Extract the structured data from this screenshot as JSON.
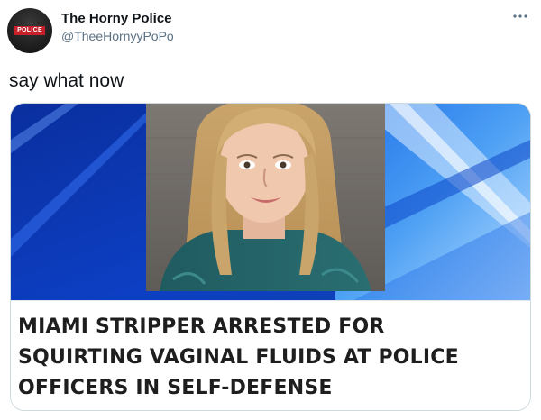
{
  "author": {
    "display_name": "The Horny Police",
    "handle": "@TheeHornyyPoPo",
    "avatar_badge_text": "POLICE"
  },
  "tweet": {
    "text": "say what now",
    "more_icon": "ellipsis-icon"
  },
  "card": {
    "headline_lines": [
      "MIAMI STRIPPER ARRESTED FOR",
      "SQUIRTING VAGINAL FLUIDS AT POLICE",
      "OFFICERS IN SELF-DEFENSE"
    ],
    "image_description_icon": "mugshot-photo"
  },
  "colors": {
    "text_primary": "#0f1419",
    "text_secondary": "#5b7083",
    "card_border": "#cfd9de",
    "news_blue": "#1565d8",
    "badge_red": "#c6202a"
  }
}
